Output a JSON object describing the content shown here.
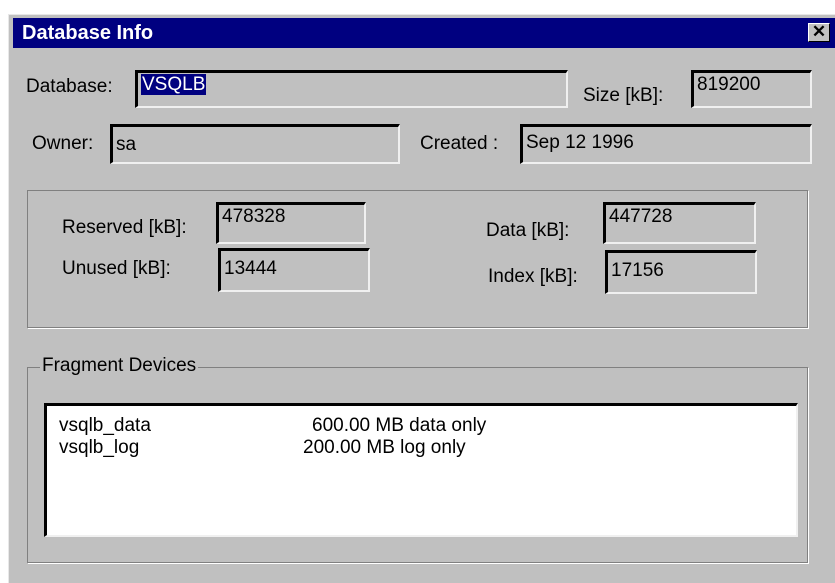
{
  "window": {
    "title": "Database Info",
    "close_glyph": "✕"
  },
  "fields": {
    "database": {
      "label": "Database:",
      "value": "VSQLB"
    },
    "size": {
      "label": "Size [kB]:",
      "value": "819200"
    },
    "owner": {
      "label": "Owner:",
      "value": "sa"
    },
    "created": {
      "label": "Created :",
      "value": "Sep 12 1996"
    },
    "reserved": {
      "label": "Reserved [kB]:",
      "value": "478328"
    },
    "unused": {
      "label": "Unused [kB]:",
      "value": "13444"
    },
    "data": {
      "label": "Data [kB]:",
      "value": "447728"
    },
    "index": {
      "label": "Index [kB]:",
      "value": "17156"
    }
  },
  "fragment_devices": {
    "label": "Fragment Devices",
    "rows": [
      {
        "name": "vsqlb_data",
        "info": "600.00 MB data only"
      },
      {
        "name": "vsqlb_log",
        "info": "200.00 MB log only"
      }
    ]
  },
  "colors": {
    "titlebar": "#000080",
    "face": "#c0c0c0",
    "selection": "#000080"
  }
}
